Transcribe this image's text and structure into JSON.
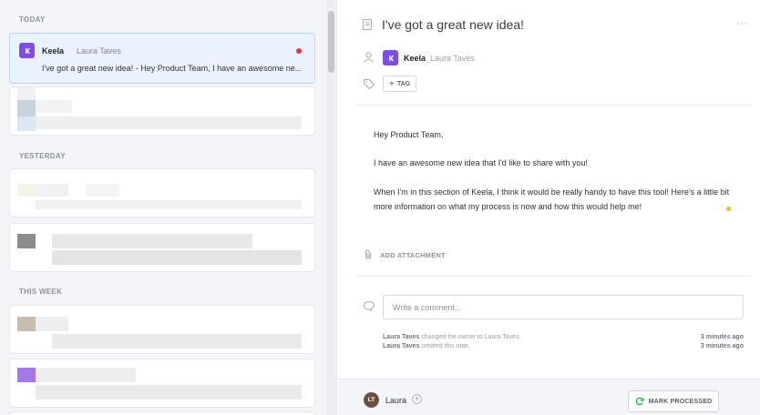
{
  "sidebar": {
    "sections": [
      {
        "label": "TODAY"
      },
      {
        "label": "YESTERDAY"
      },
      {
        "label": "THIS WEEK"
      }
    ],
    "selected_card": {
      "app_name": "Keela",
      "owner": "Laura Taves",
      "preview": "I've got a great new idea! - Hey Product Team, I have an awesome ne...",
      "unread": true
    }
  },
  "detail": {
    "title": "I've got a great new idea!",
    "more_label": "···",
    "app_name": "Keela",
    "owner": "Laura Taves",
    "tag_label": "TAG",
    "body": [
      "Hey Product Team,",
      "I have an awesome new idea that I'd like to share with you!",
      "When I'm in this section of Keela, I think it would be really handy to have this tool! Here's a little bit",
      "more information on what my process is now and how this would help me!"
    ],
    "attachment_label": "ADD ATTACHMENT",
    "comment_placeholder": "Write a comment...",
    "activity": [
      {
        "user": "Laura Taves",
        "text": " changed the owner to Laura Taves.",
        "when": "3 minutes ago"
      },
      {
        "user": "Laura Taves",
        "text": " created this note.",
        "when": "3 minutes ago"
      }
    ]
  },
  "footer": {
    "avatar_initials": "LT",
    "user_name": "Laura",
    "mark_processed_label": "MARK PROCESSED"
  },
  "colors": {
    "accent_purple": "#7c4dea",
    "unread_red": "#e8344a",
    "processed_green": "#2bb55a"
  }
}
